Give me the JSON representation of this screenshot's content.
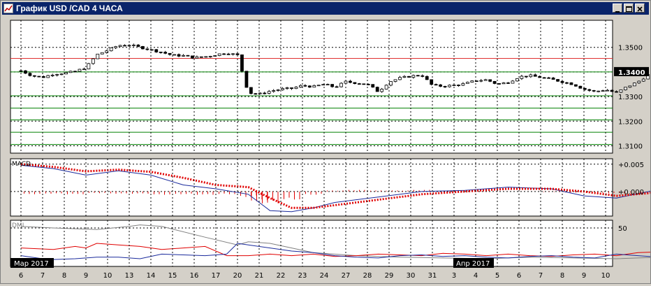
{
  "window": {
    "title": "График USD /CAD  4 ЧАСА",
    "buttons": [
      "minimize",
      "maximize",
      "close"
    ]
  },
  "colors": {
    "grid": "#000000",
    "hline_red": "#e03030",
    "hline_green": "#008000",
    "candle_body": "#000000",
    "price_badge_bg": "#000000",
    "price_badge_fg": "#ffffff",
    "macd_line": "#1a2a9c",
    "signal_line": "#e00000",
    "dmi_plus": "#e00000",
    "dmi_minus": "#1a2a9c",
    "adx": "#808080"
  },
  "chart_data": [
    {
      "type": "candlestick",
      "panel": "price",
      "symbol": "USD/CAD",
      "timeframe": "4H",
      "y_ticks": [
        "1.3500",
        "1.3300",
        "1.3200",
        "1.3100"
      ],
      "current_price": "1.3400",
      "ylim": [
        1.307,
        1.361
      ],
      "horizontal_levels_red": [
        1.3455
      ],
      "horizontal_levels_green": [
        1.34,
        1.3303,
        1.3253,
        1.3205,
        1.3155,
        1.3105
      ],
      "close_path": [
        [
          5.5,
          1.3405
        ],
        [
          6,
          1.3385
        ],
        [
          6.5,
          1.3378
        ],
        [
          7,
          1.3392
        ],
        [
          7.5,
          1.3395
        ],
        [
          8,
          1.3402
        ],
        [
          8.5,
          1.3418
        ],
        [
          9,
          1.347
        ],
        [
          9.5,
          1.3488
        ],
        [
          10,
          1.3508
        ],
        [
          10.5,
          1.351
        ],
        [
          11,
          1.35
        ],
        [
          11.5,
          1.349
        ],
        [
          12,
          1.348
        ],
        [
          12.5,
          1.3468
        ],
        [
          13,
          1.3466
        ],
        [
          13.5,
          1.3458
        ],
        [
          14,
          1.3462
        ],
        [
          14.5,
          1.347
        ],
        [
          15,
          1.3478
        ],
        [
          15.5,
          1.3468
        ],
        [
          16,
          1.3315
        ],
        [
          16.5,
          1.331
        ],
        [
          17,
          1.3322
        ],
        [
          17.5,
          1.333
        ],
        [
          18,
          1.3333
        ],
        [
          18.5,
          1.3345
        ],
        [
          19,
          1.334
        ],
        [
          19.5,
          1.335
        ],
        [
          20,
          1.3338
        ],
        [
          20.5,
          1.336
        ],
        [
          21,
          1.3355
        ],
        [
          21.5,
          1.335
        ],
        [
          22,
          1.332
        ],
        [
          22.5,
          1.336
        ],
        [
          23,
          1.3375
        ],
        [
          23.5,
          1.3383
        ],
        [
          24,
          1.3388
        ],
        [
          24.5,
          1.3345
        ],
        [
          25,
          1.3342
        ],
        [
          25.5,
          1.3346
        ],
        [
          26,
          1.3352
        ],
        [
          26.5,
          1.3365
        ],
        [
          27,
          1.3368
        ],
        [
          27.5,
          1.335
        ],
        [
          28,
          1.3358
        ],
        [
          28.5,
          1.338
        ],
        [
          29,
          1.3385
        ],
        [
          29.5,
          1.3378
        ],
        [
          30,
          1.337
        ],
        [
          30.5,
          1.336
        ],
        [
          31,
          1.335
        ],
        [
          31.5,
          1.333
        ],
        [
          32,
          1.332
        ],
        [
          32.5,
          1.3328
        ],
        [
          33,
          1.3315
        ],
        [
          33.5,
          1.334
        ],
        [
          34,
          1.336
        ],
        [
          34.5,
          1.339
        ],
        [
          35,
          1.3398
        ],
        [
          35.5,
          1.344
        ],
        [
          36,
          1.342
        ],
        [
          36.5,
          1.341
        ],
        [
          37,
          1.34
        ],
        [
          37.5,
          1.3422
        ],
        [
          38,
          1.344
        ],
        [
          38.5,
          1.3448
        ],
        [
          39,
          1.3442
        ],
        [
          39.5,
          1.342
        ],
        [
          40,
          1.3402
        ]
      ],
      "x_day_labels": [
        "6",
        "7",
        "8",
        "9",
        "10",
        "13",
        "14",
        "15",
        "16",
        "17",
        "20",
        "21",
        "22",
        "23",
        "24",
        "27",
        "28",
        "29",
        "30",
        "31",
        "3",
        "4",
        "5",
        "6",
        "7",
        "8",
        "9",
        "10"
      ],
      "x_month_labels": [
        "Мар 2017",
        "Апр 2017"
      ]
    },
    {
      "type": "line",
      "panel": "macd",
      "title": "MACD",
      "y_ticks": [
        "+0.005",
        "+0.000"
      ],
      "ylim": [
        -0.0045,
        0.006
      ],
      "series": [
        {
          "name": "MACD",
          "style": "line",
          "points": [
            [
              5.5,
              0.0048
            ],
            [
              7,
              0.0042
            ],
            [
              8.5,
              0.003
            ],
            [
              10,
              0.0038
            ],
            [
              11.5,
              0.003
            ],
            [
              13,
              0.0012
            ],
            [
              14.5,
              0.0005
            ],
            [
              16,
              -0.0005
            ],
            [
              17,
              -0.0035
            ],
            [
              18,
              -0.0037
            ],
            [
              19,
              -0.003
            ],
            [
              20,
              -0.002
            ],
            [
              22,
              -0.001
            ],
            [
              24,
              0.0
            ],
            [
              26,
              0.0002
            ],
            [
              28,
              0.0008
            ],
            [
              30,
              0.0005
            ],
            [
              31.5,
              -0.0008
            ],
            [
              33,
              -0.0012
            ],
            [
              34.5,
              0.0
            ],
            [
              36,
              0.0018
            ],
            [
              38,
              0.0022
            ],
            [
              39,
              0.002
            ],
            [
              40,
              0.0012
            ]
          ]
        },
        {
          "name": "Signal",
          "style": "dotted",
          "points": [
            [
              5.5,
              0.005
            ],
            [
              7,
              0.0045
            ],
            [
              8.5,
              0.0037
            ],
            [
              10,
              0.004
            ],
            [
              11.5,
              0.0036
            ],
            [
              13,
              0.0025
            ],
            [
              14.5,
              0.0012
            ],
            [
              16,
              0.0008
            ],
            [
              17,
              -0.0012
            ],
            [
              18,
              -0.003
            ],
            [
              19,
              -0.003
            ],
            [
              20,
              -0.0025
            ],
            [
              22,
              -0.0015
            ],
            [
              24,
              -0.0005
            ],
            [
              26,
              0.0
            ],
            [
              28,
              0.0005
            ],
            [
              30,
              0.0005
            ],
            [
              31.5,
              0.0
            ],
            [
              33,
              -0.0008
            ],
            [
              34.5,
              -0.0003
            ],
            [
              36,
              0.0012
            ],
            [
              38,
              0.002
            ],
            [
              39,
              0.0018
            ],
            [
              40,
              0.0015
            ]
          ]
        },
        {
          "name": "Histogram",
          "style": "bars",
          "points": [
            [
              6,
              -0.0005
            ],
            [
              7,
              -0.0004
            ],
            [
              8,
              -0.0005
            ],
            [
              9,
              -0.0003
            ],
            [
              10,
              -0.0004
            ],
            [
              11,
              -0.0004
            ],
            [
              12,
              -0.0006
            ],
            [
              13,
              -0.0005
            ],
            [
              14,
              -0.0006
            ],
            [
              15,
              -0.0005
            ],
            [
              16,
              -0.001
            ],
            [
              16.5,
              -0.0018
            ],
            [
              17,
              -0.0022
            ],
            [
              18,
              -0.0015
            ],
            [
              19,
              -0.0006
            ],
            [
              20,
              0.0002
            ],
            [
              21,
              0.0003
            ],
            [
              22,
              0.0002
            ],
            [
              23,
              0.0002
            ],
            [
              24,
              0.0003
            ],
            [
              25,
              0.0
            ],
            [
              26,
              0.0
            ],
            [
              27,
              0.0
            ],
            [
              28,
              0.0
            ],
            [
              29,
              0.0
            ],
            [
              30,
              -0.0001
            ],
            [
              31,
              -0.0002
            ],
            [
              32,
              -0.0003
            ],
            [
              33,
              -0.0003
            ],
            [
              34,
              -0.0002
            ],
            [
              35,
              0.0003
            ],
            [
              36,
              0.0004
            ],
            [
              37,
              0.0004
            ],
            [
              38,
              0.0003
            ],
            [
              39,
              0.0002
            ]
          ]
        }
      ]
    },
    {
      "type": "line",
      "panel": "dmi",
      "title": "DMI",
      "y_ticks": [
        "50"
      ],
      "ylim": [
        0,
        60
      ],
      "series": [
        {
          "name": "ADX",
          "style": "line",
          "points": [
            [
              5.5,
              52
            ],
            [
              7,
              50
            ],
            [
              9,
              48
            ],
            [
              10.5,
              52
            ],
            [
              11,
              54
            ],
            [
              12,
              52
            ],
            [
              14,
              38
            ],
            [
              15.5,
              28
            ],
            [
              16,
              32
            ],
            [
              17,
              30
            ],
            [
              18,
              24
            ],
            [
              19,
              18
            ],
            [
              21,
              14
            ],
            [
              23,
              12
            ],
            [
              25,
              11
            ],
            [
              27,
              10
            ],
            [
              29,
              12
            ],
            [
              31,
              11
            ],
            [
              33,
              10
            ],
            [
              35,
              12
            ],
            [
              37,
              16
            ],
            [
              38.5,
              18
            ],
            [
              40,
              14
            ]
          ]
        },
        {
          "name": "+DI",
          "style": "line",
          "points": [
            [
              5.5,
              24
            ],
            [
              7,
              22
            ],
            [
              8,
              26
            ],
            [
              8.5,
              24
            ],
            [
              9,
              30
            ],
            [
              10,
              28
            ],
            [
              11,
              26
            ],
            [
              12,
              22
            ],
            [
              13,
              24
            ],
            [
              14,
              26
            ],
            [
              15,
              14
            ],
            [
              16,
              14
            ],
            [
              17,
              16
            ],
            [
              18,
              14
            ],
            [
              19,
              16
            ],
            [
              20,
              13
            ],
            [
              21,
              14
            ],
            [
              22,
              16
            ],
            [
              23,
              15
            ],
            [
              24,
              14
            ],
            [
              25,
              17
            ],
            [
              26,
              16
            ],
            [
              27,
              14
            ],
            [
              28,
              16
            ],
            [
              29,
              14
            ],
            [
              30,
              13
            ],
            [
              31,
              15
            ],
            [
              32,
              16
            ],
            [
              33,
              14
            ],
            [
              34,
              18
            ],
            [
              35,
              19
            ],
            [
              36,
              21
            ],
            [
              37,
              20
            ],
            [
              38,
              19
            ],
            [
              39,
              18
            ],
            [
              40,
              16
            ]
          ]
        },
        {
          "name": "-DI",
          "style": "line",
          "points": [
            [
              5.5,
              14
            ],
            [
              6.5,
              10
            ],
            [
              7,
              9
            ],
            [
              8,
              10
            ],
            [
              9,
              12
            ],
            [
              10,
              12
            ],
            [
              11,
              10
            ],
            [
              12,
              16
            ],
            [
              13,
              15
            ],
            [
              14,
              14
            ],
            [
              15,
              16
            ],
            [
              15.5,
              30
            ],
            [
              16,
              28
            ],
            [
              17,
              24
            ],
            [
              18,
              20
            ],
            [
              19,
              18
            ],
            [
              20,
              14
            ],
            [
              21,
              12
            ],
            [
              22,
              11
            ],
            [
              23,
              14
            ],
            [
              24,
              15
            ],
            [
              25,
              13
            ],
            [
              26,
              14
            ],
            [
              27,
              12
            ],
            [
              28,
              11
            ],
            [
              29,
              13
            ],
            [
              30,
              14
            ],
            [
              31,
              12
            ],
            [
              32,
              11
            ],
            [
              33,
              16
            ],
            [
              34,
              14
            ],
            [
              35,
              12
            ],
            [
              36,
              13
            ],
            [
              37,
              14
            ],
            [
              38,
              15
            ],
            [
              39,
              13
            ],
            [
              40,
              14
            ]
          ]
        }
      ]
    }
  ]
}
